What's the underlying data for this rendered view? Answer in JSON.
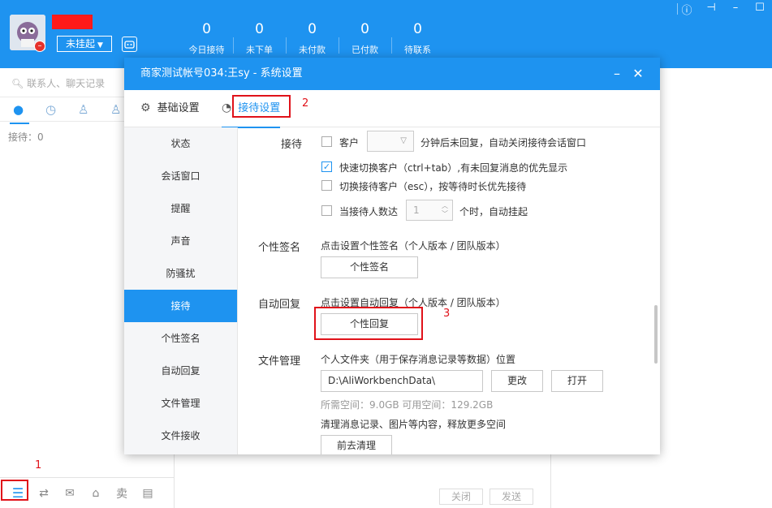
{
  "app": {
    "status_label": "未挂起",
    "stats": [
      {
        "value": "0",
        "label": "今日接待"
      },
      {
        "value": "0",
        "label": "未下单"
      },
      {
        "value": "0",
        "label": "未付款"
      },
      {
        "value": "0",
        "label": "已付款"
      },
      {
        "value": "0",
        "label": "待联系"
      }
    ],
    "colors": {
      "brand": "#1e93f0",
      "annotation": "#e0121a"
    }
  },
  "left": {
    "search_placeholder": "联系人、聊天记录",
    "reception_label": "接待：0"
  },
  "chat": {
    "close_label": "关闭",
    "send_label": "发送"
  },
  "dialog": {
    "title": "商家测试帐号034:王sy - 系统设置",
    "tabs": {
      "basic": "基础设置",
      "reception": "接待设置"
    },
    "nav": [
      "状态",
      "会话窗口",
      "提醒",
      "声音",
      "防骚扰",
      "接待",
      "个性签名",
      "自动回复",
      "文件管理",
      "文件接收"
    ],
    "reception": {
      "label": "接待",
      "opt1_prefix": "客户",
      "opt1_suffix": "分钟后未回复，自动关闭接待会话窗口",
      "opt2": "快速切换客户（ctrl+tab）,有未回复消息的优先显示",
      "opt3": "切换接待客户（esc），按等待时长优先接待",
      "opt4_prefix": "当接待人数达",
      "opt4_value": "1",
      "opt4_suffix": "个时，自动挂起"
    },
    "signature": {
      "label": "个性签名",
      "desc": "点击设置个性签名（个人版本 / 团队版本）",
      "button": "个性签名"
    },
    "auto_reply": {
      "label": "自动回复",
      "desc": "点击设置自动回复（个人版本 / 团队版本）",
      "button": "个性回复"
    },
    "files": {
      "label": "文件管理",
      "desc": "个人文件夹（用于保存消息记录等数据）位置",
      "path": "D:\\AliWorkbenchData\\",
      "change": "更改",
      "open": "打开",
      "space": "所需空间：9.0GB   可用空间：129.2GB",
      "clean_desc": "清理消息记录、图片等内容，释放更多空间",
      "clean_button": "前去清理"
    }
  },
  "annotations": [
    "1",
    "2",
    "3"
  ]
}
